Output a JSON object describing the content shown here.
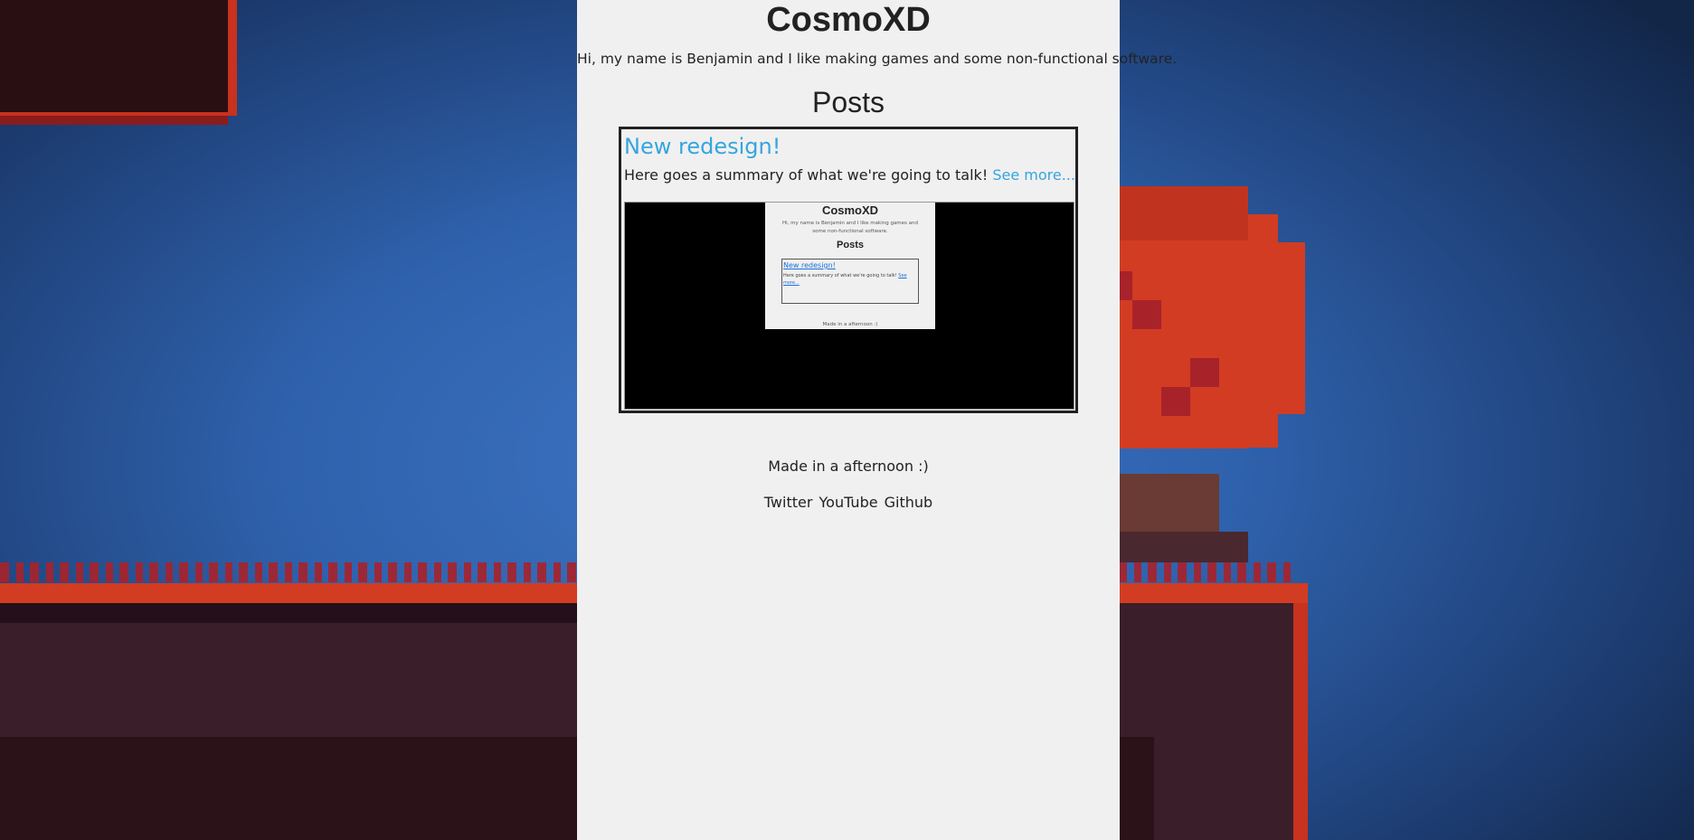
{
  "background": {
    "colors": {
      "sky": "#2f62ad",
      "red": "#d23c22",
      "dark_red": "#a8222a",
      "ground": "#3a1e2a",
      "ground_dark": "#2a1218",
      "trunk": "#6a3a34"
    }
  },
  "page": {
    "background": "#f0f0f0",
    "title": "CosmoXD",
    "intro": "Hi, my name is Benjamin and I like making games and some non-functional software.",
    "posts_heading": "Posts",
    "accent": "#35a5e0"
  },
  "post": {
    "title": "New redesign!",
    "summary": "Here goes a summary of what we're going to talk!",
    "see_more": "See more..."
  },
  "post_image": {
    "title": "CosmoXD",
    "intro": "Hi, my name is Benjamin and I like making games and some non-functional software.",
    "posts_heading": "Posts",
    "post_title": "New redesign!",
    "post_summary": "Here goes a summary of what we're going to talk!",
    "see_more": "See more...",
    "footer": "Made in a afternoon :)"
  },
  "footer": {
    "note": "Made in a afternoon :)",
    "links": [
      "Twitter",
      "YouTube",
      "Github"
    ]
  }
}
